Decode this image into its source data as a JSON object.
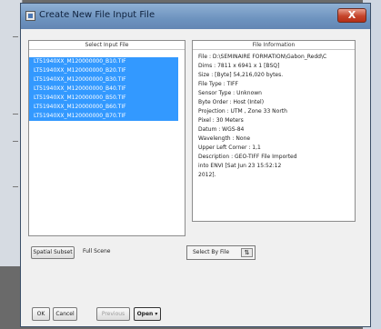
{
  "window": {
    "title": "Create New File Input File",
    "close_label": "X"
  },
  "file_pane": {
    "header": "Select Input File",
    "files": [
      "LT51940XX_M120000000_B10.TIF",
      "LT51940XX_M120000000_B20.TIF",
      "LT51940XX_M120000000_B30.TIF",
      "LT51940XX_M120000000_B40.TIF",
      "LT51940XX_M120000000_B50.TIF",
      "LT51940XX_M120000000_B60.TIF",
      "LT51940XX_M120000000_B70.TIF"
    ]
  },
  "info_pane": {
    "header": "File Information",
    "lines": [
      "File : D:\\SEMINAIRE FORMATION\\Gabon_Redd\\C",
      "Dims : 7811 x 6941 x 1 [BSQ]",
      "Size : [Byte] 54,216,020 bytes.",
      "File Type : TIFF",
      "Sensor Type : Unknown",
      "Byte Order : Host (Intel)",
      "Projection : UTM , Zone 33 North",
      "  Pixel   : 30 Meters",
      "  Datum   : WGS-84",
      "Wavelength : None",
      "Upper Left Corner : 1,1",
      "Description : GEO-TIFF File Imported",
      "into ENVI [Sat Jun 23 15:52:12",
      "2012]."
    ]
  },
  "subset": {
    "button": "Spatial Subset",
    "value": "Full Scene",
    "select_by": "Select By File",
    "sort_glyph": "⇅"
  },
  "buttons": {
    "ok": "OK",
    "cancel": "Cancel",
    "previous": "Previous",
    "open": "Open ▾"
  }
}
